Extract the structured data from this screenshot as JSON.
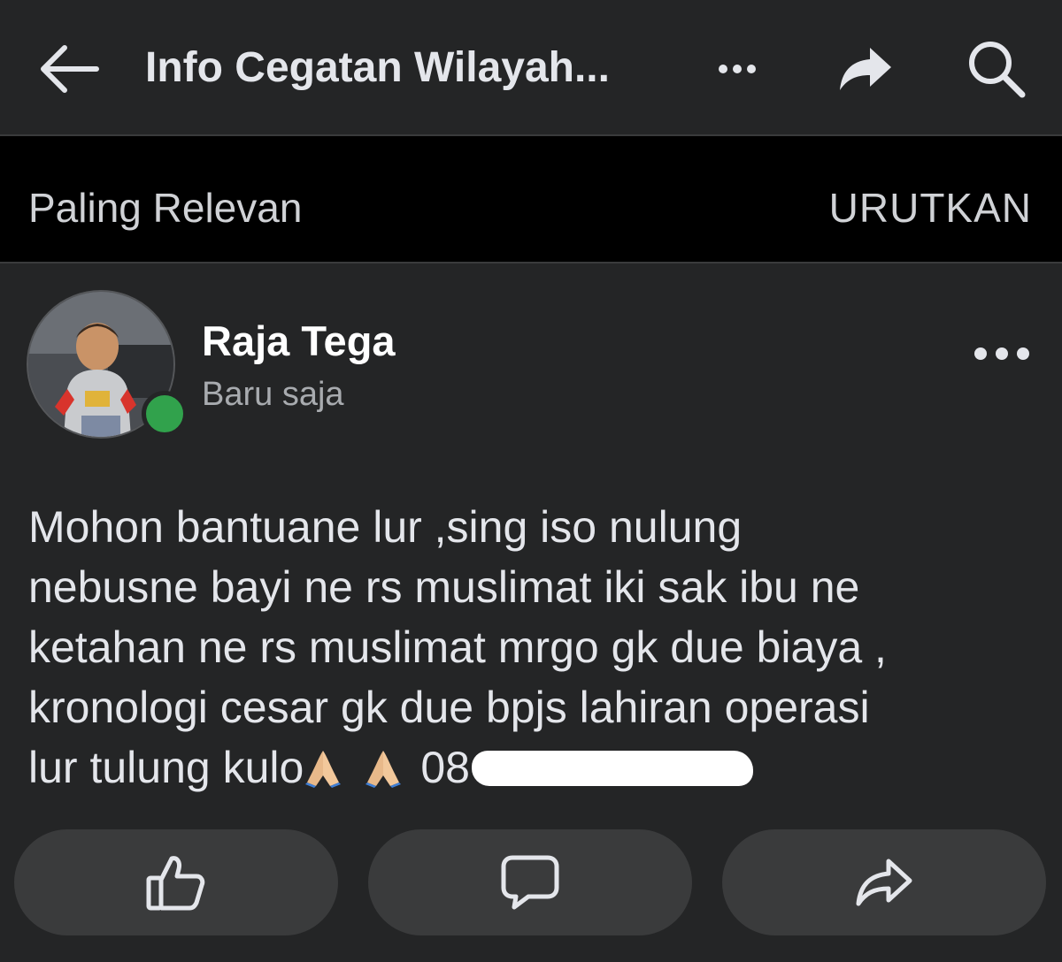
{
  "topbar": {
    "title": "Info Cegatan Wilayah...",
    "back_icon": "arrow-left-icon",
    "more_icon": "more-dots-icon",
    "share_icon": "share-arrow-icon",
    "search_icon": "search-icon"
  },
  "sortbar": {
    "label": "Paling Relevan",
    "sort_button": "URUTKAN"
  },
  "post": {
    "author": "Raja Tega",
    "time": "Baru saja",
    "online": true,
    "lines": [
      "Mohon bantuane lur ,sing iso nulung",
      "nebusne bayi ne rs muslimat iki sak ibu ne",
      "ketahan ne rs muslimat mrgo gk due biaya ,",
      "kronologi cesar gk due bpjs lahiran operasi"
    ],
    "last_line_text": "lur tulung kulo",
    "phone_prefix": "08",
    "emoji": "folded-hands-emoji"
  },
  "actions": {
    "like_icon": "thumbs-up-icon",
    "comment_icon": "comment-bubble-icon",
    "share_icon": "share-icon"
  },
  "colors": {
    "background": "#242526",
    "sortbar_background": "#000000",
    "button_background": "#3a3b3c",
    "text": "#e4e6eb",
    "secondary_text": "#a8abaf",
    "online": "#31a24c"
  }
}
